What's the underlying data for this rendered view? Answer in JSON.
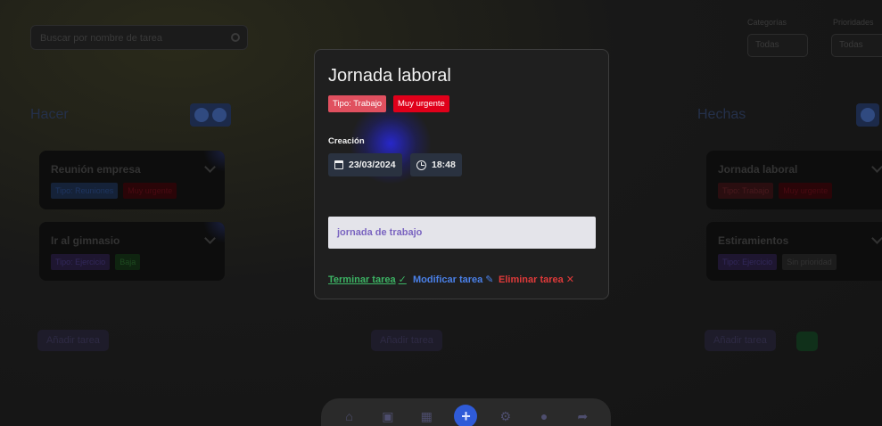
{
  "background": {
    "search_placeholder": "Buscar por nombre de tarea",
    "filters": [
      {
        "label": "Categorías",
        "value": "Todas"
      },
      {
        "label": "Prioridades",
        "value": "Todas"
      }
    ],
    "columns": [
      {
        "title": "Hacer",
        "add_label": "Añadir tarea",
        "cards": [
          {
            "title": "Reunión empresa",
            "tags": [
              "Tipo: Reuniones",
              "Muy urgente"
            ]
          },
          {
            "title": "Ir al gimnasio",
            "tags": [
              "Tipo: Ejercicio",
              "Baja"
            ]
          }
        ]
      },
      {
        "title": "",
        "add_label": "Añadir tarea",
        "cards": []
      },
      {
        "title": "Hechas",
        "add_label": "Añadir tarea",
        "cards": [
          {
            "title": "Jornada laboral",
            "tags": [
              "Tipo: Trabajo",
              "Muy urgente"
            ]
          },
          {
            "title": "Estiramientos",
            "tags": [
              "Tipo: Ejercicio",
              "Sin prioridad"
            ]
          }
        ]
      }
    ]
  },
  "modal": {
    "title": "Jornada laboral",
    "type_badge": "Tipo: Trabajo",
    "urgency_badge": "Muy urgente",
    "creation_label": "Creación",
    "date": "23/03/2024",
    "time": "18:48",
    "description": "jornada de trabajo",
    "actions": {
      "finish": "Terminar tarea",
      "finish_icon": "✓",
      "modify": "Modificar tarea",
      "modify_icon": "✎",
      "delete": "Eliminar tarea",
      "delete_icon": "✕"
    }
  },
  "bottom_nav": {
    "items": [
      {
        "name": "home-icon",
        "glyph": "⌂"
      },
      {
        "name": "wallet-icon",
        "glyph": "▣"
      },
      {
        "name": "calendar-icon",
        "glyph": "▦"
      },
      {
        "name": "add-icon",
        "glyph": "+"
      },
      {
        "name": "filters-icon",
        "glyph": "⚙"
      },
      {
        "name": "user-icon",
        "glyph": "●"
      },
      {
        "name": "share-icon",
        "glyph": "➦"
      }
    ]
  },
  "colors": {
    "type_badge": "#e0505f",
    "urgency_badge": "#e0001a",
    "finish": "#3cb464",
    "modify": "#4a80e8",
    "delete": "#e03a3a",
    "accent": "#2f5bd8"
  }
}
